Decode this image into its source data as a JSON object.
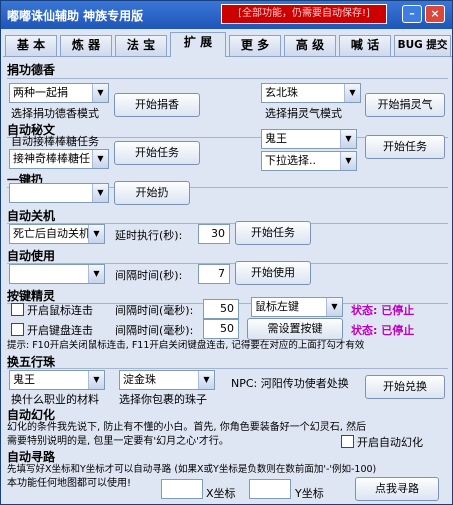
{
  "window": {
    "title": "嘟嘟诛仙辅助  神族专用版",
    "notice": "[全部功能，仍需要自动保存!]",
    "min_icon": "minimize-icon",
    "close_icon": "close-icon",
    "min_glyph": "–",
    "close_glyph": "×"
  },
  "tabs": [
    "基 本",
    "炼 器",
    "法 宝",
    "扩 展",
    "更 多",
    "高 级",
    "喊 话",
    "BUG 提交"
  ],
  "active_tab": "扩 展",
  "juan": {
    "title": "捐功德香",
    "left_select": "两种一起捐",
    "left_hint": "选择捐功德香模式",
    "left_button": "开始捐香",
    "right_select": "玄北珠",
    "right_hint": "选择捐灵气模式",
    "right_button": "开始捐灵气"
  },
  "mijue": {
    "title": "自动秘文",
    "hint": "自动接棒棒糖任务",
    "left_select": "接神奇棒棒糖任",
    "left_button": "开始任务",
    "right_select1": "鬼王",
    "right_select2": "下拉选择..",
    "right_button": "开始任务"
  },
  "yijian": {
    "title": "一键扔",
    "select": "",
    "button": "开始扔"
  },
  "shutdown": {
    "title": "自动关机",
    "select": "死亡后自动关机",
    "delay_label": "延时执行(秒):",
    "delay_value": "30",
    "button": "开始任务"
  },
  "autouse": {
    "title": "自动使用",
    "select": "",
    "interval_label": "间隔时间(秒):",
    "interval_value": "7",
    "button": "开始使用"
  },
  "jingling": {
    "title": "按键精灵",
    "mouse_check": "开启鼠标连击",
    "mouse_interval_label": "间隔时间(毫秒):",
    "mouse_interval_value": "50",
    "mouse_select": "鼠标左键",
    "mouse_status": "状态: 已停止",
    "kb_check": "开启键盘连击",
    "kb_interval_label": "间隔时间(毫秒):",
    "kb_interval_value": "50",
    "kb_button": "需设置按键",
    "kb_status": "状态: 已停止",
    "tip": "提示: F10开启关闭鼠标连击, F11开启关闭键盘连击, 记得要在对应的上面打勾才有效"
  },
  "wuxing": {
    "title": "换五行珠",
    "left_select": "鬼王",
    "left_hint": "换什么职业的材料",
    "mid_select": "淀金珠",
    "mid_hint": "选择你包裹的珠子",
    "npc": "NPC: 河阳传功使者处换",
    "button": "开始兑换"
  },
  "huanhua": {
    "title": "自动幻化",
    "line1": "幻化的条件我先说下, 防止有不懂的小白。首先, 你角色要装备好一个幻灵石, 然后",
    "line2": "需要特别说明的是, 包里一定要有'幻月之心'才行。",
    "check": "开启自动幻化"
  },
  "xunlu": {
    "title": "自动寻路",
    "line1": "先填写好X坐标和Y坐标才可以自动寻路 (如果X或Y坐标是负数则在数前面加'-'例如-100)",
    "line2": "本功能任何地图都可以使用!",
    "x_value": "",
    "x_label": "X坐标",
    "y_value": "",
    "y_label": "Y坐标",
    "button": "点我寻路"
  },
  "colors": {
    "title_bar": "#1f56b7",
    "notice_bg": "#cc0000",
    "status": "#c000c0",
    "window_bg": "#dfe6f3"
  }
}
